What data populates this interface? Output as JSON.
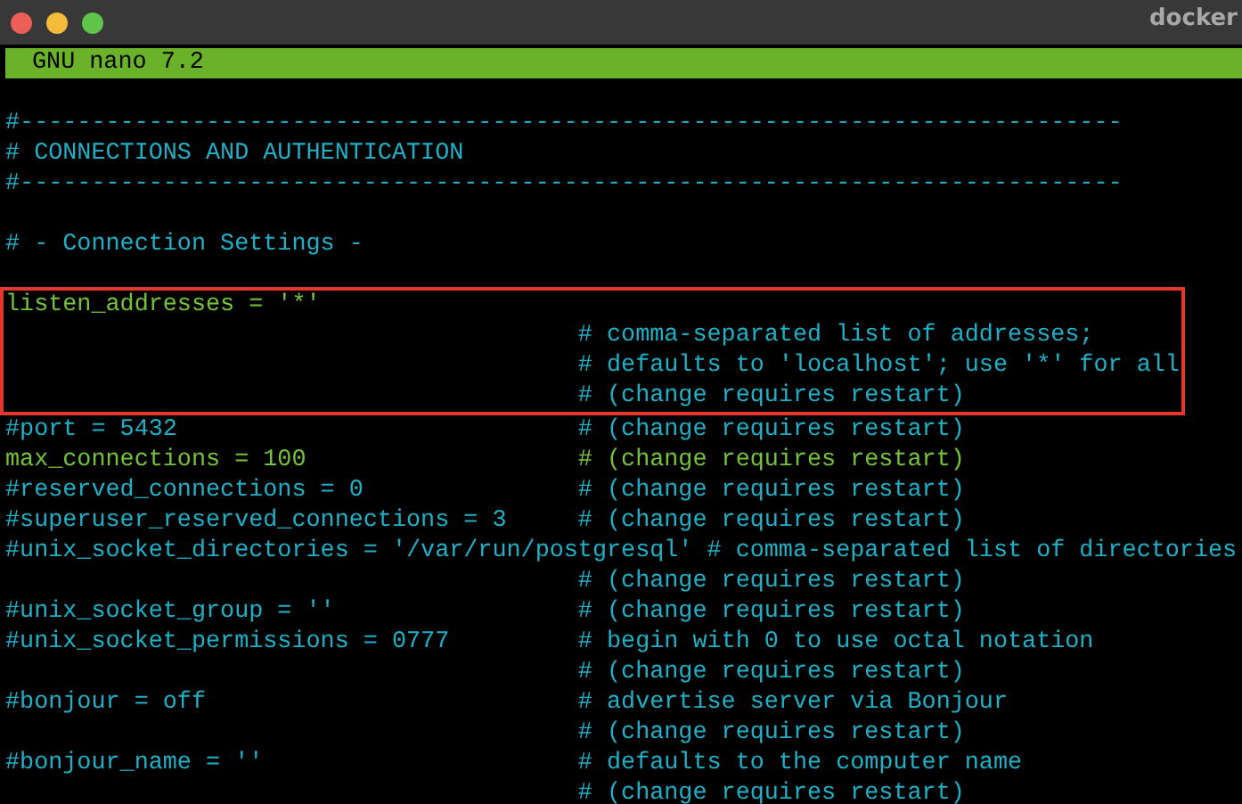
{
  "window": {
    "title": "docker"
  },
  "editor_header": {
    "title": "GNU nano 7.2"
  },
  "lines": [
    {
      "kind": "blank"
    },
    {
      "kind": "comment",
      "text": "#-----------------------------------------------------------------------------"
    },
    {
      "kind": "comment",
      "text": "# CONNECTIONS AND AUTHENTICATION"
    },
    {
      "kind": "comment",
      "text": "#-----------------------------------------------------------------------------"
    },
    {
      "kind": "blank"
    },
    {
      "kind": "comment",
      "text": "# - Connection Settings -"
    },
    {
      "kind": "blank"
    },
    {
      "kind": "highlight",
      "lines": [
        {
          "kind": "setting",
          "text": "listen_addresses = '*'"
        },
        {
          "kind": "comment",
          "text": "                                        # comma-separated list of addresses;"
        },
        {
          "kind": "comment",
          "text": "                                        # defaults to 'localhost'; use '*' for all"
        },
        {
          "kind": "comment",
          "text": "                                        # (change requires restart)"
        }
      ]
    },
    {
      "kind": "comment",
      "text": "#port = 5432                            # (change requires restart)"
    },
    {
      "kind": "setting",
      "text": "max_connections = 100                   # (change requires restart)"
    },
    {
      "kind": "comment",
      "text": "#reserved_connections = 0               # (change requires restart)"
    },
    {
      "kind": "comment",
      "text": "#superuser_reserved_connections = 3     # (change requires restart)"
    },
    {
      "kind": "comment",
      "text": "#unix_socket_directories = '/var/run/postgresql' # comma-separated list of directories"
    },
    {
      "kind": "comment",
      "text": "                                        # (change requires restart)"
    },
    {
      "kind": "comment",
      "text": "#unix_socket_group = ''                 # (change requires restart)"
    },
    {
      "kind": "comment",
      "text": "#unix_socket_permissions = 0777         # begin with 0 to use octal notation"
    },
    {
      "kind": "comment",
      "text": "                                        # (change requires restart)"
    },
    {
      "kind": "comment",
      "text": "#bonjour = off                          # advertise server via Bonjour"
    },
    {
      "kind": "comment",
      "text": "                                        # (change requires restart)"
    },
    {
      "kind": "comment",
      "text": "#bonjour_name = ''                      # defaults to the computer name"
    },
    {
      "kind": "comment",
      "text": "                                        # (change requires restart)"
    }
  ]
}
